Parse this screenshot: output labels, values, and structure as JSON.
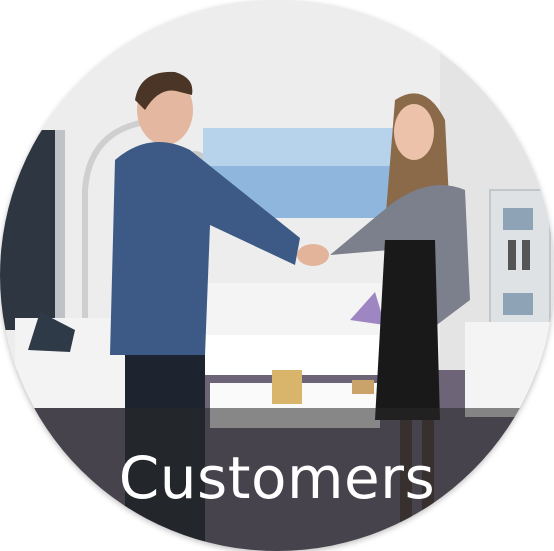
{
  "tile": {
    "caption": "Customers"
  },
  "colors": {
    "caption_text": "#ffffff",
    "caption_band": "#282828",
    "wall": "#eeeeee",
    "carpet": "#6e6478",
    "sofa": "#f4f4f4",
    "man_jacket": "#3d5a86",
    "woman_cardigan": "#7c7f8c"
  }
}
